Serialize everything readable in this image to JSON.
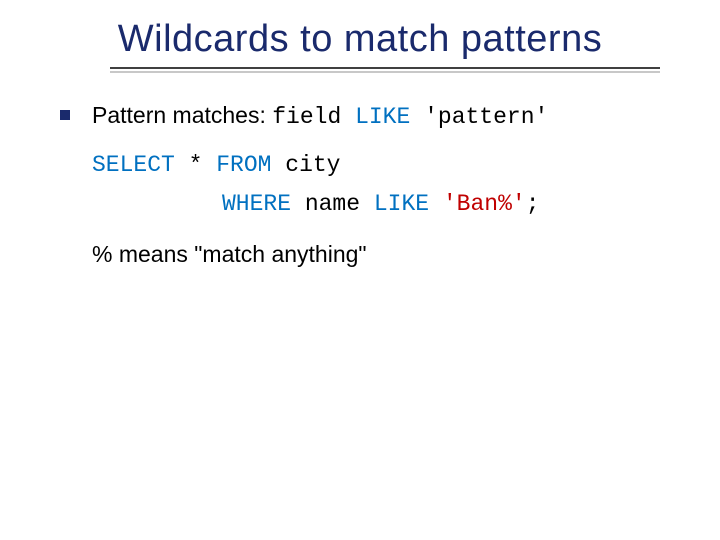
{
  "title": "Wildcards to match patterns",
  "bullet": {
    "intro_plain": "Pattern matches:  ",
    "intro_code_pre": "field ",
    "intro_code_kw": "LIKE",
    "intro_code_post": " 'pattern'",
    "sql": {
      "l1_kw1": "SELECT",
      "l1_t1": " * ",
      "l1_kw2": "FROM",
      "l1_t2": " city",
      "l2_kw1": "WHERE",
      "l2_t1": " name ",
      "l2_kw2": "LIKE",
      "l2_t2": " ",
      "l2_str": "'Ban%'",
      "l2_t3": ";"
    },
    "note": "% means \"match anything\""
  }
}
